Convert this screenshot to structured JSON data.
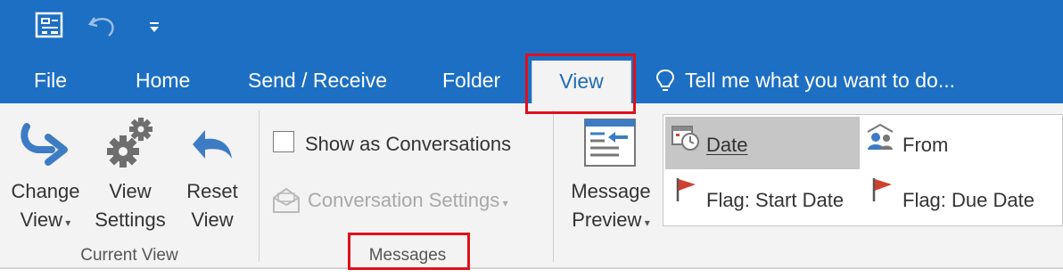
{
  "tabs": {
    "file": "File",
    "home": "Home",
    "send_receive": "Send / Receive",
    "folder": "Folder",
    "view": "View"
  },
  "tell_me": "Tell me what you want to do...",
  "current_view": {
    "change_view_line1": "Change",
    "change_view_line2": "View",
    "view_settings_line1": "View",
    "view_settings_line2": "Settings",
    "reset_view_line1": "Reset",
    "reset_view_line2": "View",
    "group_label": "Current View"
  },
  "messages": {
    "show_as_conversations": "Show as Conversations",
    "conversation_settings": "Conversation Settings",
    "group_label": "Messages"
  },
  "arrangement": {
    "message_preview_line1": "Message",
    "message_preview_line2": "Preview",
    "date": "Date",
    "from": "From",
    "flag_start": "Flag: Start Date",
    "flag_due": "Flag: Due Date"
  }
}
